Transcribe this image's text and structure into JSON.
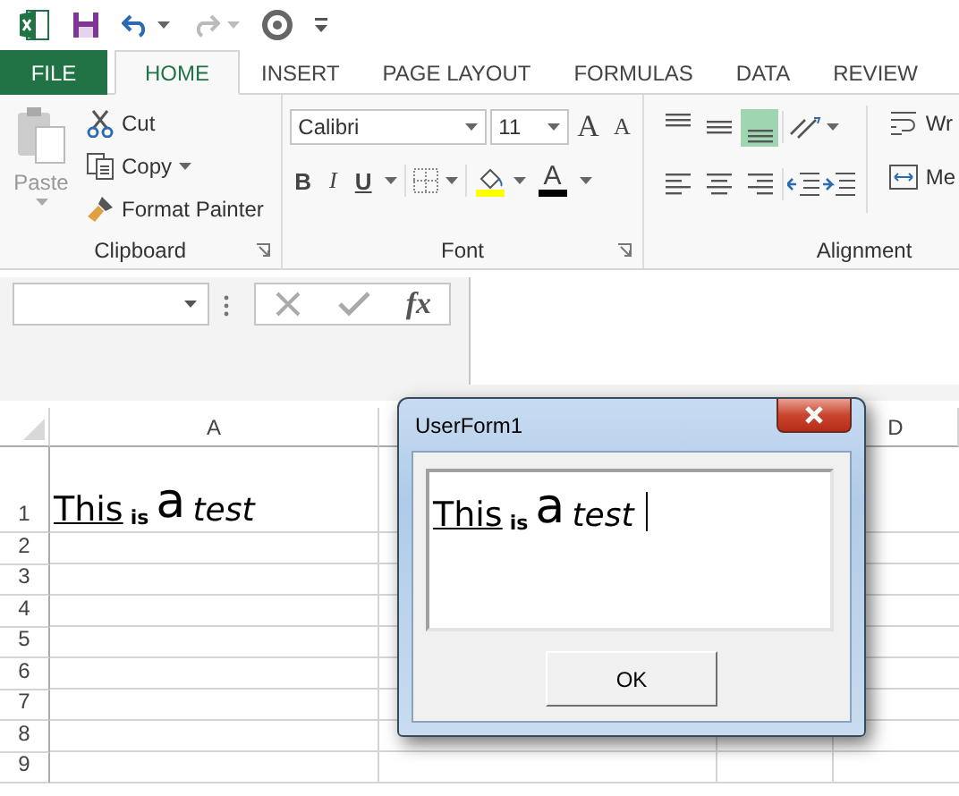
{
  "ribbon_tabs": [
    {
      "label": "FILE",
      "kind": "file",
      "selected": false
    },
    {
      "label": "HOME",
      "kind": "tab",
      "selected": true
    },
    {
      "label": "INSERT",
      "kind": "tab",
      "selected": false
    },
    {
      "label": "PAGE LAYOUT",
      "kind": "tab",
      "selected": false
    },
    {
      "label": "FORMULAS",
      "kind": "tab",
      "selected": false
    },
    {
      "label": "DATA",
      "kind": "tab",
      "selected": false
    },
    {
      "label": "REVIEW",
      "kind": "tab",
      "selected": false
    }
  ],
  "clipboard": {
    "paste": {
      "label": "Paste",
      "disabled": true
    },
    "cut": "Cut",
    "copy": "Copy",
    "format_painter": "Format Painter",
    "label": "Clipboard"
  },
  "font": {
    "font_name": "Calibri",
    "font_size": "11",
    "grow": "A",
    "shrink": "A",
    "bold": "B",
    "italic": "I",
    "underline": "U",
    "font_color": "A",
    "label": "Font"
  },
  "alignment": {
    "buttons": [
      {
        "kind": "top",
        "selected": false
      },
      {
        "kind": "middle",
        "selected": false
      },
      {
        "kind": "bottom",
        "selected": true
      }
    ],
    "buttons_2": [
      {
        "kind": "left",
        "selected": false
      },
      {
        "kind": "center",
        "selected": false
      },
      {
        "kind": "right",
        "selected": false
      }
    ],
    "wrap": "Wr",
    "merge": "Me",
    "label": "Alignment"
  },
  "formula_bar": {
    "fx": "fx"
  },
  "sheet": {
    "columns": [
      "A",
      "D"
    ],
    "rows": [
      "1",
      "2",
      "3",
      "4",
      "5",
      "6",
      "7",
      "8",
      "9"
    ],
    "cell_a1": [
      {
        "text": "This",
        "kind": "underlined"
      },
      {
        "text": "is",
        "kind": "small-bold"
      },
      {
        "text": "a",
        "kind": "large"
      },
      {
        "text": "test",
        "kind": "italic"
      }
    ]
  },
  "dialog": {
    "title": "UserForm1",
    "textbox": [
      {
        "text": "This",
        "kind": "underlined"
      },
      {
        "text": "is",
        "kind": "small-bold"
      },
      {
        "text": "a",
        "kind": "large"
      },
      {
        "text": "test",
        "kind": "italic"
      }
    ],
    "ok": "OK"
  }
}
